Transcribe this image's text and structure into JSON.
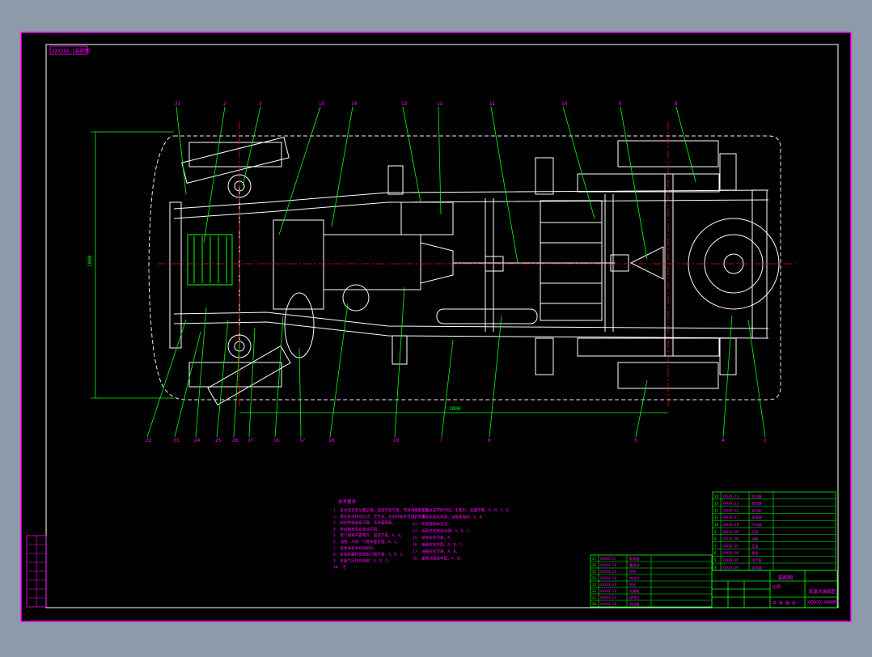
{
  "window": {
    "background": "#8e9aaa"
  },
  "drawing": {
    "sheet_color": "#000000",
    "code_label": "XXXXXX-1装配图",
    "colors": {
      "frame_border": "#ff00ff",
      "outline": "#ffffff",
      "leader": "#00ff00",
      "centerline": "#ff0000",
      "tech_text": "#ff00ff",
      "table": "#00ff00",
      "table_text": "#ff00ff"
    },
    "dimensions": {
      "overall_length": "3800",
      "overall_width": "1800"
    },
    "balloons_top": [
      "21",
      "2",
      "3",
      "15",
      "14",
      "13",
      "12",
      "11",
      "10",
      "9",
      "8"
    ],
    "balloons_bottom": [
      "22",
      "23",
      "24",
      "25",
      "26",
      "27",
      "16",
      "17",
      "18",
      "19",
      "7",
      "6",
      "5",
      "4",
      "1"
    ],
    "tech_requirements": {
      "title": "技术要求",
      "lines_left": [
        "1. 各总成安装位置正确，连接牢固可靠，零部件装配齐全。",
        "2. 转向系统转动灵活，无卡滞，左右转角符合设计要求。",
        "3. 制动管路连接可靠，无渗漏现象。",
        "4. 传动轴安装后转动平稳。",
        "5. 电气线路布置整齐，固定可靠，A、B。",
        "6. 油管、水管、气管布置合理，B、C。",
        "7. 其余按有关标准执行。",
        "8. 各连接螺栓按规定力矩拧紧，A、B、C。",
        "9. 轮胎气压符合规定，A、B、C。",
        "10. 注"
      ],
      "lines_right": [
        "11. 车架总成焊接牢固，无变形，表面平整，A、B、C、D。",
        "12. 发动机安装牢固，减振垫完好，A、B。",
        "13. 变速器操纵灵活。",
        "14. 后桥总成安装正确，A、B、C。",
        "15. 悬架安装可靠，A。",
        "16. 备胎安装牢固，A、B、C。",
        "17. 油箱安装可靠，A、B。",
        "18. 蓄电池固定牢固，A、B。"
      ]
    },
    "parts_list_upper": [
      {
        "no": "14",
        "code": "XXXXX-14",
        "name": "转向器"
      },
      {
        "no": "13",
        "code": "XXXXX-13",
        "name": "离合器"
      },
      {
        "no": "12",
        "code": "XXXXX-12",
        "name": "发动机"
      },
      {
        "no": "11",
        "code": "XXXXX-11",
        "name": "变速器"
      },
      {
        "no": "10",
        "code": "XXXXX-10",
        "name": "传动轴"
      },
      {
        "no": "9",
        "code": "XXXXX-09",
        "name": "后桥"
      },
      {
        "no": "8",
        "code": "XXXXX-08",
        "name": "油箱"
      },
      {
        "no": "7",
        "code": "XXXXX-07",
        "name": "车架"
      },
      {
        "no": "6",
        "code": "XXXXX-06",
        "name": "备胎"
      },
      {
        "no": "5",
        "code": "XXXXX-05",
        "name": "排气管"
      },
      {
        "no": "4",
        "code": "XXXXX-04",
        "name": "消声器"
      }
    ],
    "parts_list_lower": [
      {
        "no": "27",
        "code": "XXXXX-27",
        "name": "散热器"
      },
      {
        "no": "26",
        "code": "XXXXX-26",
        "name": "蓄电池"
      },
      {
        "no": "25",
        "code": "XXXXX-25",
        "name": "前桥"
      },
      {
        "no": "24",
        "code": "XXXXX-24",
        "name": "转向节"
      },
      {
        "no": "23",
        "code": "XXXXX-23",
        "name": "前轮"
      },
      {
        "no": "22",
        "code": "XXXXX-22",
        "name": "前悬架"
      },
      {
        "no": "21",
        "code": "XXXXX-21",
        "name": "保险杠"
      },
      {
        "no": "20",
        "code": "XXXXX-20",
        "name": "制动器"
      }
    ],
    "title_block": {
      "title": "底盘总装配图",
      "company": "装配图",
      "drawing_no": "XXXXXX-000000",
      "scale_label": "比例",
      "sheet_label": "共 张 第 张"
    },
    "left_side_table_rows": 8
  }
}
